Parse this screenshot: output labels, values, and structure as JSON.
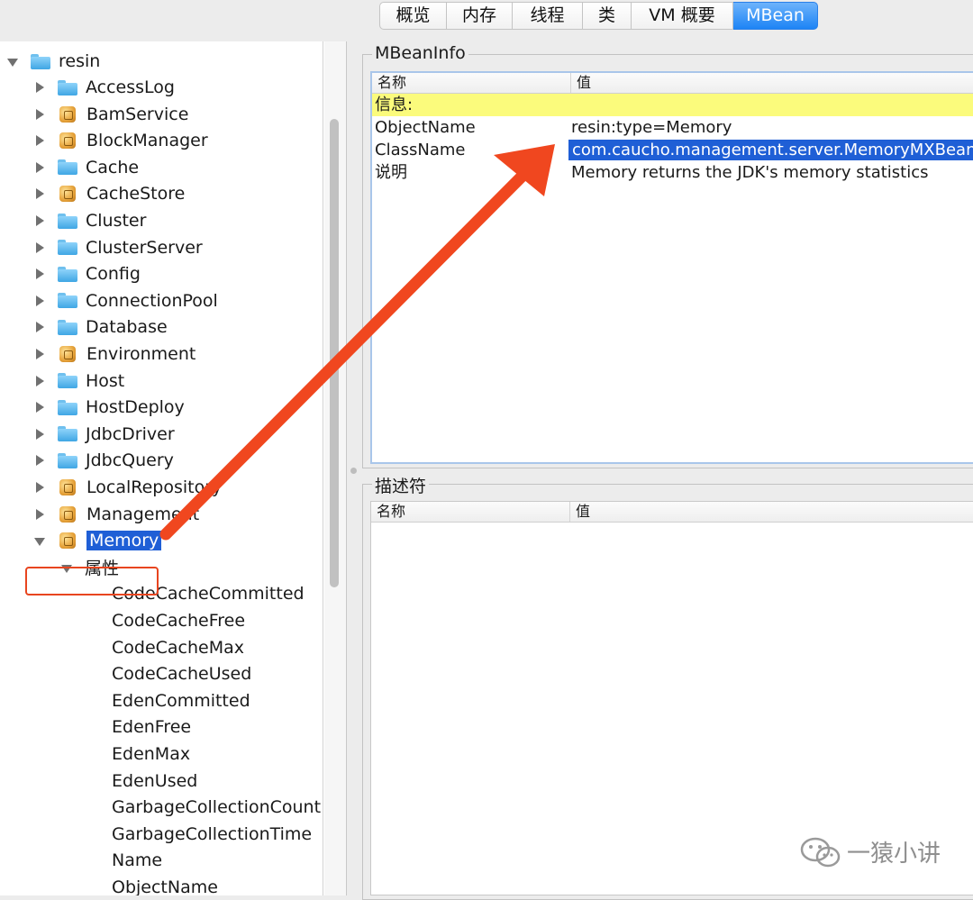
{
  "tabs": [
    {
      "label": "概览",
      "width": 0
    },
    {
      "label": "内存"
    },
    {
      "label": "线程"
    },
    {
      "label": "类"
    },
    {
      "label": "VM 概要"
    },
    {
      "label": "MBean",
      "active": true
    }
  ],
  "tree": {
    "root": "resin",
    "items": [
      {
        "label": "AccessLog",
        "icon": "folder-icon"
      },
      {
        "label": "BamService",
        "icon": "mbean-icon"
      },
      {
        "label": "BlockManager",
        "icon": "mbean-icon"
      },
      {
        "label": "Cache",
        "icon": "folder-icon"
      },
      {
        "label": "CacheStore",
        "icon": "mbean-icon"
      },
      {
        "label": "Cluster",
        "icon": "folder-icon"
      },
      {
        "label": "ClusterServer",
        "icon": "folder-icon"
      },
      {
        "label": "Config",
        "icon": "folder-icon"
      },
      {
        "label": "ConnectionPool",
        "icon": "folder-icon"
      },
      {
        "label": "Database",
        "icon": "folder-icon"
      },
      {
        "label": "Environment",
        "icon": "mbean-icon"
      },
      {
        "label": "Host",
        "icon": "folder-icon"
      },
      {
        "label": "HostDeploy",
        "icon": "folder-icon"
      },
      {
        "label": "JdbcDriver",
        "icon": "folder-icon"
      },
      {
        "label": "JdbcQuery",
        "icon": "folder-icon"
      },
      {
        "label": "LocalRepository",
        "icon": "mbean-icon"
      },
      {
        "label": "Management",
        "icon": "mbean-icon"
      }
    ],
    "selected": "Memory",
    "attributes_label": "属性",
    "attributes": [
      "CodeCacheCommitted",
      "CodeCacheFree",
      "CodeCacheMax",
      "CodeCacheUsed",
      "EdenCommitted",
      "EdenFree",
      "EdenMax",
      "EdenUsed",
      "GarbageCollectionCount",
      "GarbageCollectionTime",
      "Name",
      "ObjectName"
    ]
  },
  "mbean_info": {
    "title": "MBeanInfo",
    "col_name": "名称",
    "col_value": "值",
    "rows": [
      {
        "name": "信息:",
        "value": ""
      },
      {
        "name": "ObjectName",
        "value": "resin:type=Memory"
      },
      {
        "name": "ClassName",
        "value": "com.caucho.management.server.MemoryMXBean"
      },
      {
        "name": "说明",
        "value": "Memory returns the JDK's memory statistics"
      }
    ]
  },
  "descriptor": {
    "title": "描述符",
    "col_name": "名称",
    "col_value": "值"
  },
  "watermark": "一猿小讲",
  "colors": {
    "selection": "#1f5fd6",
    "arrow": "#f0471f",
    "info_row": "#fbfb7c",
    "active_tab": "#1d84f5"
  }
}
